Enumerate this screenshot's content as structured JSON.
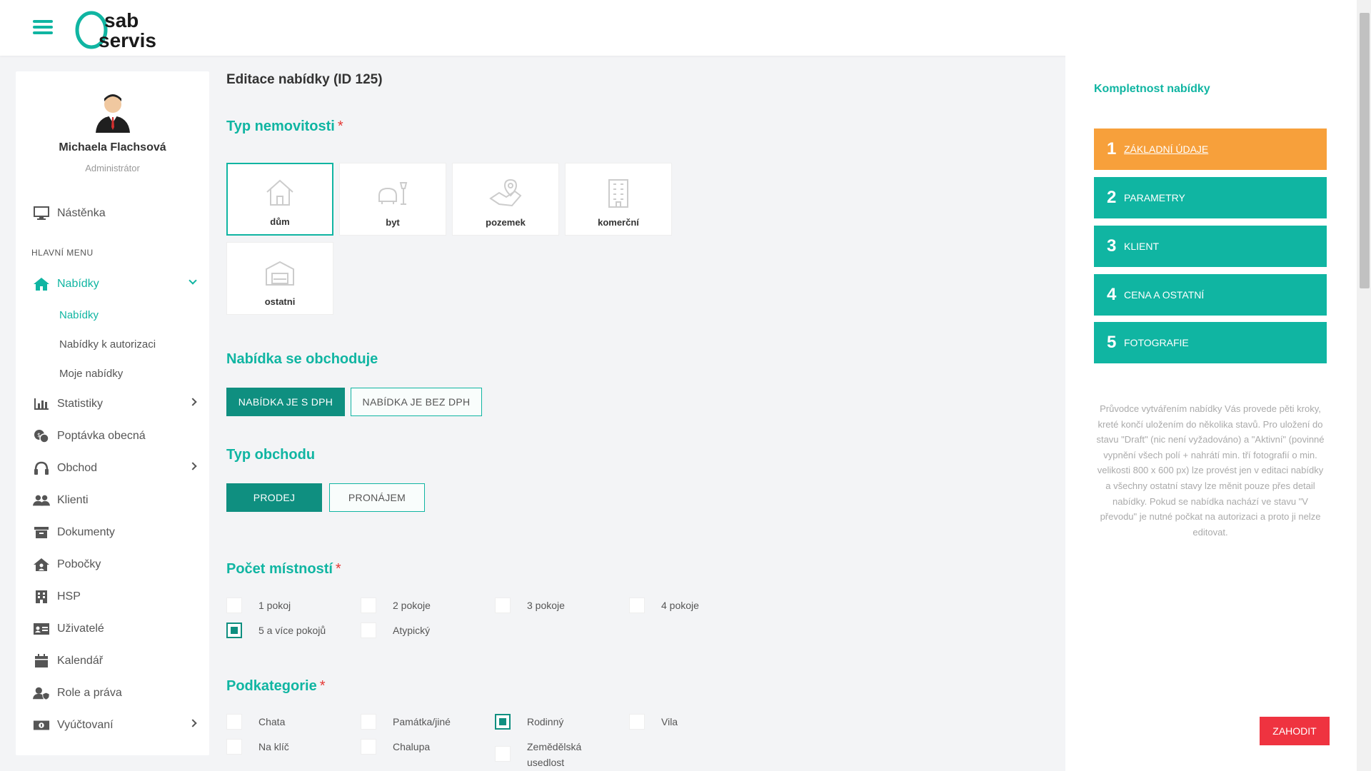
{
  "header": {
    "logo_top": "sab",
    "logo_bottom": "servis"
  },
  "user": {
    "name": "Michaela Flachsová",
    "role": "Administrátor"
  },
  "sidebar": {
    "dashboard": "Nástěnka",
    "section_label": "HLAVNÍ MENU",
    "items": [
      {
        "label": "Nabídky"
      },
      {
        "label": "Statistiky"
      },
      {
        "label": "Poptávka obecná"
      },
      {
        "label": "Obchod"
      },
      {
        "label": "Klienti"
      },
      {
        "label": "Dokumenty"
      },
      {
        "label": "Pobočky"
      },
      {
        "label": "HSP"
      },
      {
        "label": "Uživatelé"
      },
      {
        "label": "Kalendář"
      },
      {
        "label": "Role a práva"
      },
      {
        "label": "Vyúčtovaní"
      }
    ],
    "sub_items": [
      {
        "label": "Nabídky"
      },
      {
        "label": "Nabídky k autorizaci"
      },
      {
        "label": "Moje nabídky"
      }
    ]
  },
  "main": {
    "page_title": "Editace nabídky (ID 125)",
    "property_type": {
      "title": "Typ nemovitosti",
      "required": "*",
      "options": [
        {
          "label": "dům",
          "icon": "house-icon"
        },
        {
          "label": "byt",
          "icon": "armchair-lamp-icon"
        },
        {
          "label": "pozemek",
          "icon": "map-pin-icon"
        },
        {
          "label": "komerční",
          "icon": "office-building-icon"
        },
        {
          "label": "ostatni",
          "icon": "garage-icon"
        }
      ],
      "selected": "dům"
    },
    "vat": {
      "title": "Nabídka se obchoduje",
      "options": [
        "NABÍDKA JE S DPH",
        "NABÍDKA JE BEZ DPH"
      ],
      "selected": "NABÍDKA JE S DPH"
    },
    "deal_type": {
      "title": "Typ obchodu",
      "options": [
        "PRODEJ",
        "PRONÁJEM"
      ],
      "selected": "PRODEJ"
    },
    "rooms": {
      "title": "Počet místností",
      "required": "*",
      "options": [
        {
          "label": "1 pokoj",
          "checked": false
        },
        {
          "label": "2 pokoje",
          "checked": false
        },
        {
          "label": "3 pokoje",
          "checked": false
        },
        {
          "label": "4 pokoje",
          "checked": false
        },
        {
          "label": "5 a více pokojů",
          "checked": true
        },
        {
          "label": "Atypický",
          "checked": false
        }
      ]
    },
    "subcategory": {
      "title": "Podkategorie",
      "required": "*",
      "options": [
        {
          "label": "Chata",
          "checked": false
        },
        {
          "label": "Památka/jiné",
          "checked": false
        },
        {
          "label": "Rodinný",
          "checked": true
        },
        {
          "label": "Vila",
          "checked": false
        },
        {
          "label": "Na klíč",
          "checked": false
        },
        {
          "label": "Chalupa",
          "checked": false
        },
        {
          "label": "Zemědělská",
          "label2": "usedlost",
          "checked": false
        }
      ]
    }
  },
  "panel": {
    "title": "Kompletnost nabídky",
    "steps": [
      {
        "num": "1",
        "label": "Základní údaje",
        "active": true
      },
      {
        "num": "2",
        "label": "Parametry",
        "active": false
      },
      {
        "num": "3",
        "label": "Klient",
        "active": false
      },
      {
        "num": "4",
        "label": "Cena a ostatní",
        "active": false
      },
      {
        "num": "5",
        "label": "Fotografie",
        "active": false
      }
    ],
    "description": "Průvodce vytvářením nabídky Vás provede pěti kroky, kreté končí uložením do několika stavů. Pro uložení do stavu \"Draft\" (nic není vyžadováno) a \"Aktivní\" (povinné vypnění všech polí + nahrátí min. tří fotografií o min. velikosti 800 x 600 px) lze provést jen v editaci nabídky a všechny ostatní stavy lze měnit pouze přes detail nabídky. Pokud se nabídka nachází ve stavu \"V převodu\" je nutné počkat na autorizaci a proto ji nelze editovat.",
    "discard_label": "ZAHODIT"
  },
  "colors": {
    "accent": "#10b5a2",
    "accent_dark": "#0f8f80",
    "active_step": "#f7a03b",
    "danger": "#ef3340"
  }
}
